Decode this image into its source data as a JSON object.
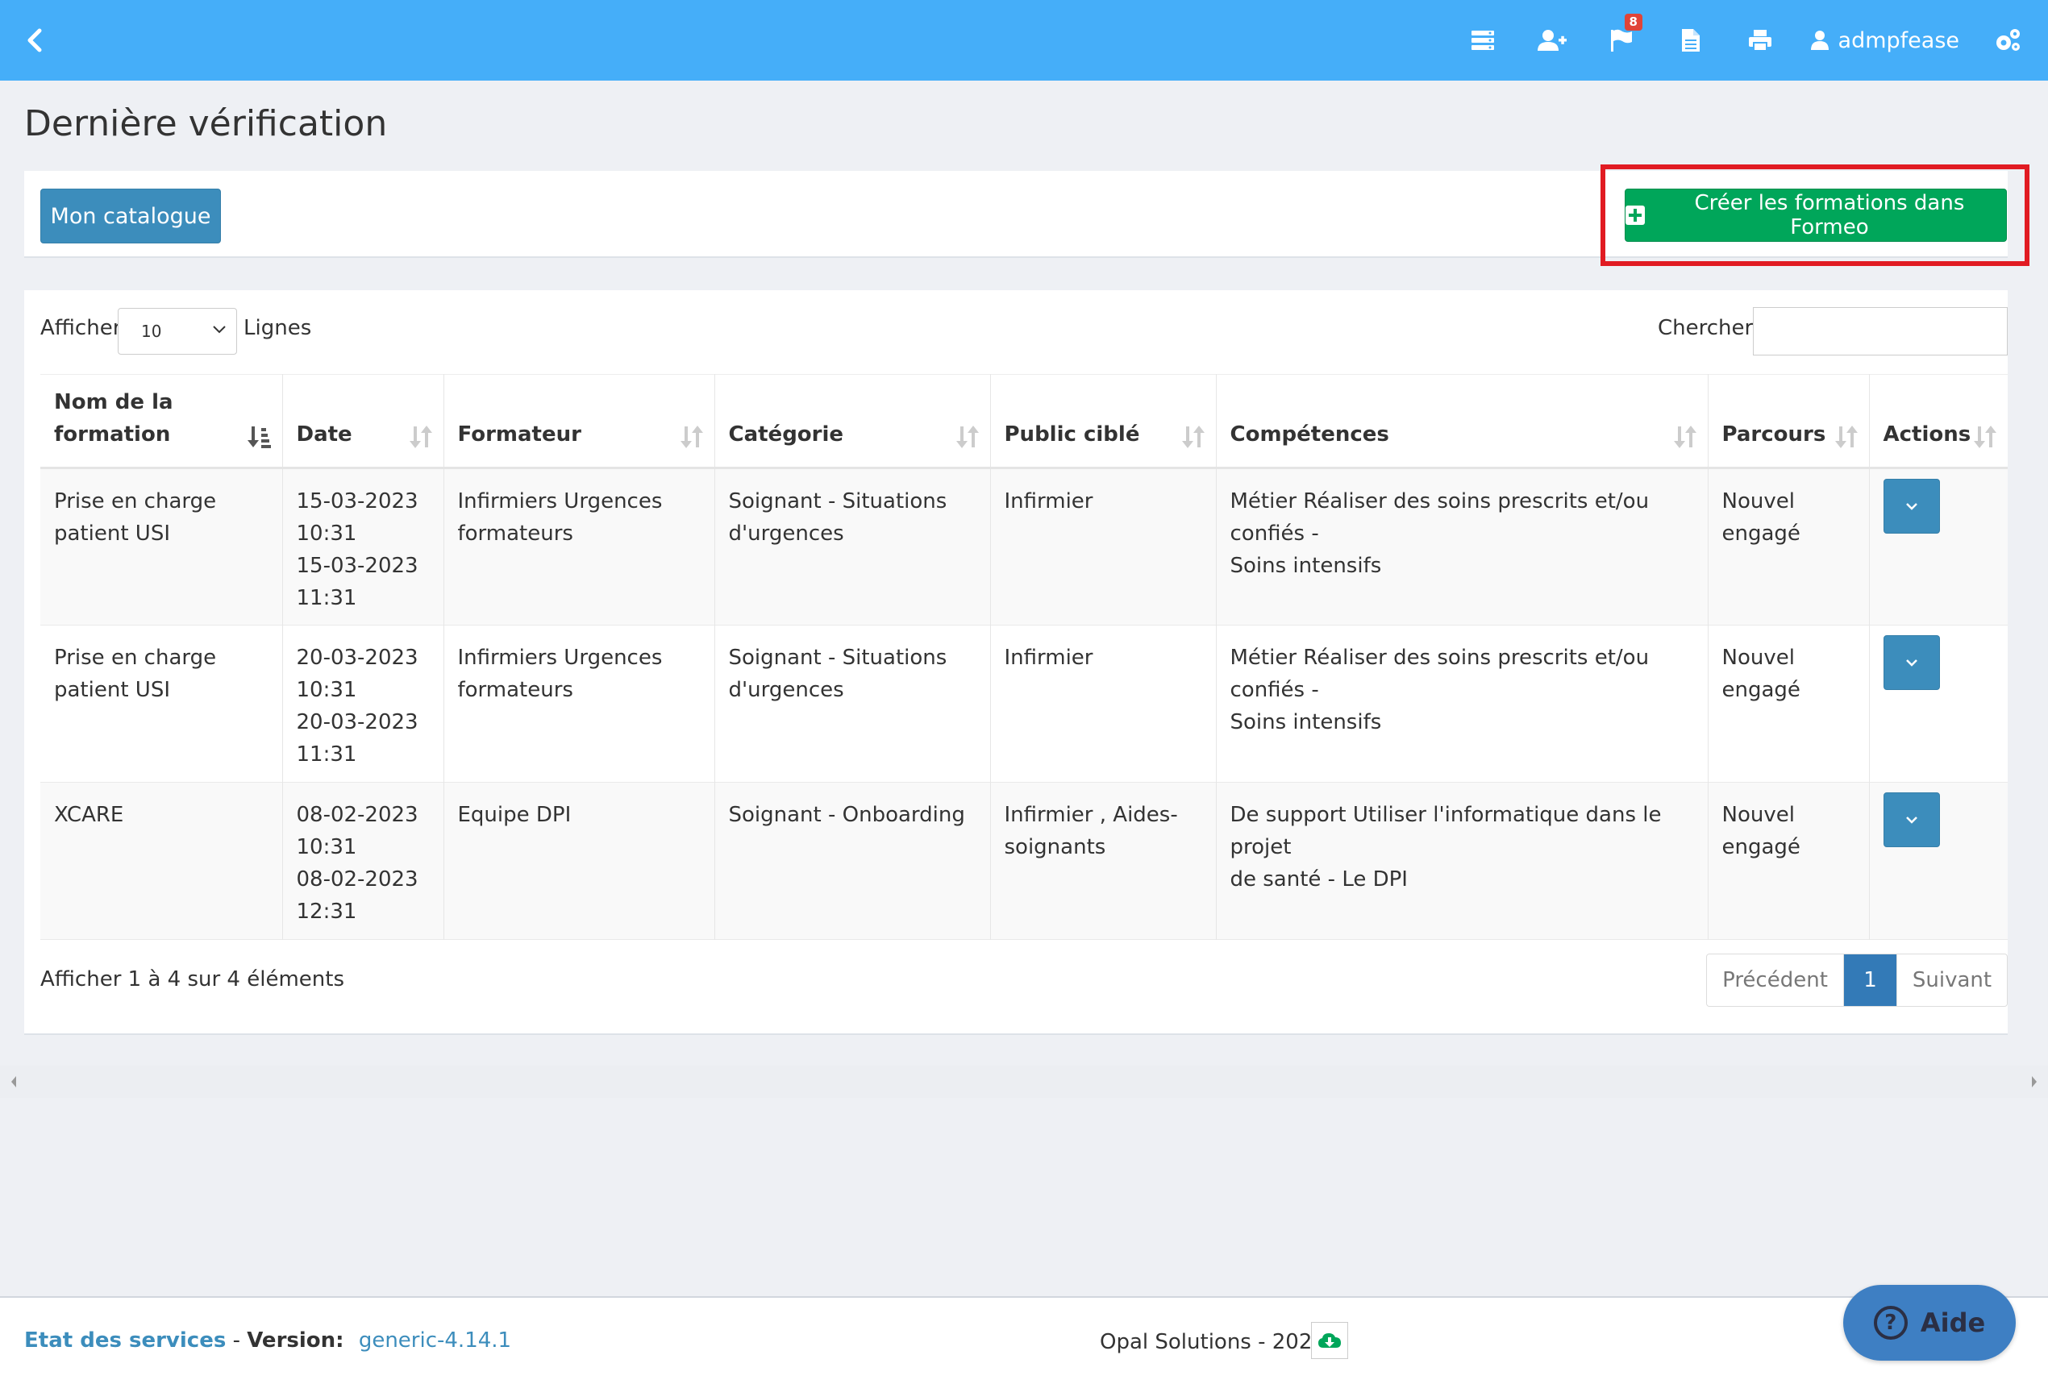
{
  "topbar": {
    "color": "#45aef9",
    "back_icon": "chevron-left-icon",
    "icons": [
      {
        "name": "server-icon"
      },
      {
        "name": "add-user-icon"
      },
      {
        "name": "flag-icon",
        "badge": "8"
      },
      {
        "name": "document-icon"
      },
      {
        "name": "print-icon"
      }
    ],
    "user_name": "admpfease",
    "settings_icon": "gears-icon"
  },
  "page": {
    "title": "Dernière vérification"
  },
  "toolbar": {
    "catalogue_label": "Mon catalogue",
    "create_label": "Créer les formations dans Formeo",
    "highlight_color": "#e11b22"
  },
  "table_controls": {
    "show_label": "Afficher",
    "length_value": "10",
    "rows_label": "Lignes",
    "search_label": "Chercher",
    "search_value": ""
  },
  "table": {
    "headers": [
      {
        "line1": "Nom de la",
        "line2": "formation"
      },
      {
        "line1": "",
        "line2": "Date"
      },
      {
        "line1": "",
        "line2": "Formateur"
      },
      {
        "line1": "",
        "line2": "Catégorie"
      },
      {
        "line1": "",
        "line2": "Public ciblé"
      },
      {
        "line1": "",
        "line2": "Compétences"
      },
      {
        "line1": "",
        "line2": "Parcours"
      },
      {
        "line1": "",
        "line2": "Actions"
      }
    ],
    "rows": [
      {
        "name": [
          "Prise en charge",
          "patient USI"
        ],
        "date": [
          "15-03-2023",
          "10:31",
          "15-03-2023",
          "11:31"
        ],
        "trainer": [
          "Infirmiers Urgences",
          "formateurs"
        ],
        "category": [
          "Soignant - Situations",
          "d'urgences"
        ],
        "audience": [
          "Infirmier",
          ""
        ],
        "skills": [
          "Métier Réaliser des soins prescrits et/ou confiés -",
          "Soins intensifs"
        ],
        "path": [
          "Nouvel",
          "engagé"
        ]
      },
      {
        "name": [
          "Prise en charge",
          "patient USI"
        ],
        "date": [
          "20-03-2023",
          "10:31",
          "20-03-2023",
          "11:31"
        ],
        "trainer": [
          "Infirmiers Urgences",
          "formateurs"
        ],
        "category": [
          "Soignant - Situations",
          "d'urgences"
        ],
        "audience": [
          "Infirmier",
          ""
        ],
        "skills": [
          "Métier Réaliser des soins prescrits et/ou confiés -",
          "Soins intensifs"
        ],
        "path": [
          "Nouvel",
          "engagé"
        ]
      },
      {
        "name": [
          "XCARE",
          ""
        ],
        "date": [
          "08-02-2023",
          "10:31",
          "08-02-2023",
          "12:31"
        ],
        "trainer": [
          "Equipe DPI",
          ""
        ],
        "category": [
          "Soignant - Onboarding",
          ""
        ],
        "audience": [
          "Infirmier , Aides-",
          "soignants"
        ],
        "skills": [
          "De support Utiliser l'informatique dans le projet",
          "de santé - Le DPI"
        ],
        "path": [
          "Nouvel",
          "engagé"
        ]
      }
    ]
  },
  "pagination": {
    "info": "Afficher 1 à 4 sur 4 éléments",
    "prev": "Précédent",
    "current": "1",
    "next": "Suivant"
  },
  "footer": {
    "status_link": "Etat des services",
    "separator": "-",
    "version_label": "Version:",
    "version": "generic-4.14.1",
    "company": "Opal Solutions - 2023",
    "cloud_icon": "cloud-download-icon"
  },
  "help": {
    "label": "Aide",
    "icon": "question-circle-icon"
  }
}
